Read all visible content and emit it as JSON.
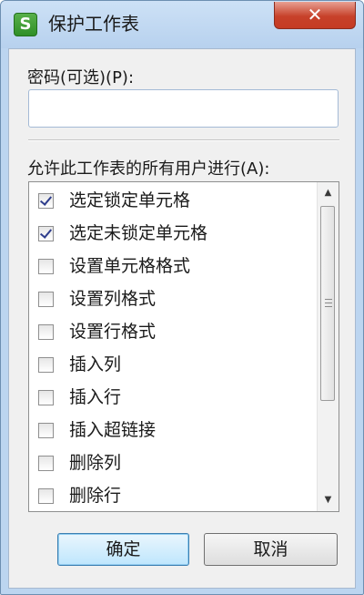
{
  "window": {
    "app_icon_glyph": "S",
    "title": "保护工作表",
    "close_glyph": "✕"
  },
  "password": {
    "label": "密码(可选)(P):",
    "value": "",
    "placeholder": ""
  },
  "permissions": {
    "label": "允许此工作表的所有用户进行(A):",
    "items": [
      {
        "label": "选定锁定单元格",
        "checked": true
      },
      {
        "label": "选定未锁定单元格",
        "checked": true
      },
      {
        "label": "设置单元格格式",
        "checked": false
      },
      {
        "label": "设置列格式",
        "checked": false
      },
      {
        "label": "设置行格式",
        "checked": false
      },
      {
        "label": "插入列",
        "checked": false
      },
      {
        "label": "插入行",
        "checked": false
      },
      {
        "label": "插入超链接",
        "checked": false
      },
      {
        "label": "删除列",
        "checked": false
      },
      {
        "label": "删除行",
        "checked": false
      }
    ],
    "scroll_up_glyph": "▲",
    "scroll_down_glyph": "▼"
  },
  "buttons": {
    "ok": "确定",
    "cancel": "取消"
  },
  "colors": {
    "title_bar": "#bcd5f0",
    "close_button": "#c53b24",
    "app_icon": "#2f8f27",
    "checkmark": "#2e3d8c"
  }
}
